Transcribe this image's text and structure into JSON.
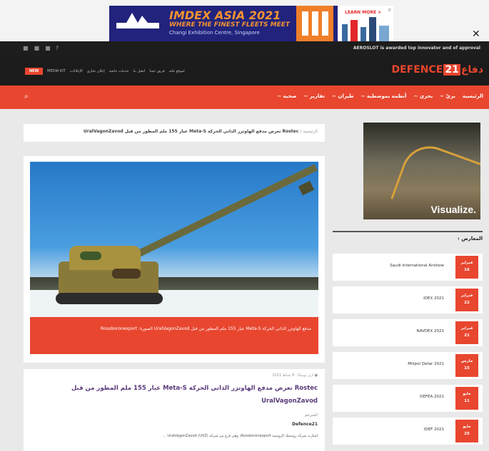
{
  "banner": {
    "title": "IMDEX ASIA 2021",
    "tagline": "WHERE THE FINEST FLEETS MEET",
    "location": "Changi Exhibition Centre, Singapore",
    "logo_text": "IMDEX ASIA 2021",
    "cta": "LEARN MORE >",
    "close": "✕",
    "ad_close": "x"
  },
  "topbar": {
    "social": [
      "■",
      "■",
      "■",
      "f"
    ],
    "ticker": "AEROSLOT is awarded top innovator and of approval"
  },
  "header": {
    "badge": "NEW",
    "links": [
      "MEDIA KIT",
      "الإعلانات",
      "إعلان تجاري",
      "خدمات خاصة",
      "اتصل بنا",
      "فريق عمنا",
      "لموقع غلبة"
    ],
    "brand_a": "DEFENCE",
    "brand_num": "21",
    "brand_b": "دفاع"
  },
  "nav": {
    "search_icon": "⌕",
    "items": [
      "الرئيسية",
      "بريّ ~",
      "بحري ~",
      "أنظمة بموضطية ~",
      "طيران ~",
      "تقارير ~",
      "صحية ~"
    ]
  },
  "breadcrumb": {
    "home": "الرئيسية /",
    "current": "Rostec تعرض مدفع الهاوتزر الذاتي الحركة Meta-S عيار 155 ملم المطور من قبل UralVagonZavod"
  },
  "featured": {
    "caption": "مدفع الهاوتزر الذاتي الحركة Meta-S عيار 155 ملم المطور من قبل UralVagonZavod الصورة: Rosoboronexport"
  },
  "article": {
    "meta": "● أرثر بوسكا · 8 شباط 2021",
    "title": "Rostec تعرض مدفع الهاوتزر الذاتي الحركة Meta-S عيار 155 ملم المطور من قبل UralVagonZavod",
    "label": "المترجم",
    "author": "Defence21",
    "snippet": "أشارت شركة روستيك الروسية Rosoboronexport، وهي فرع من شركة UralVagonZavod (UVZ) ..."
  },
  "sidebar": {
    "ad_text": "Visualize.",
    "section_title": "المعارض ›",
    "events": [
      {
        "month": "فبراير",
        "day": "16",
        "name": "Saudi International Airshow"
      },
      {
        "month": "فبراير",
        "day": "22",
        "name": "IDEX 2021"
      },
      {
        "month": "فبراير",
        "day": "21",
        "name": "NAVDEX 2021"
      },
      {
        "month": "مارس",
        "day": "15",
        "name": "Milipol Qatar 2021"
      },
      {
        "month": "مايو",
        "day": "11",
        "name": "DEFEA 2021"
      },
      {
        "month": "مايو",
        "day": "25",
        "name": "IDEF 2021"
      }
    ]
  },
  "colors": {
    "accent": "#e8462f",
    "dark": "#1b1b1b"
  }
}
